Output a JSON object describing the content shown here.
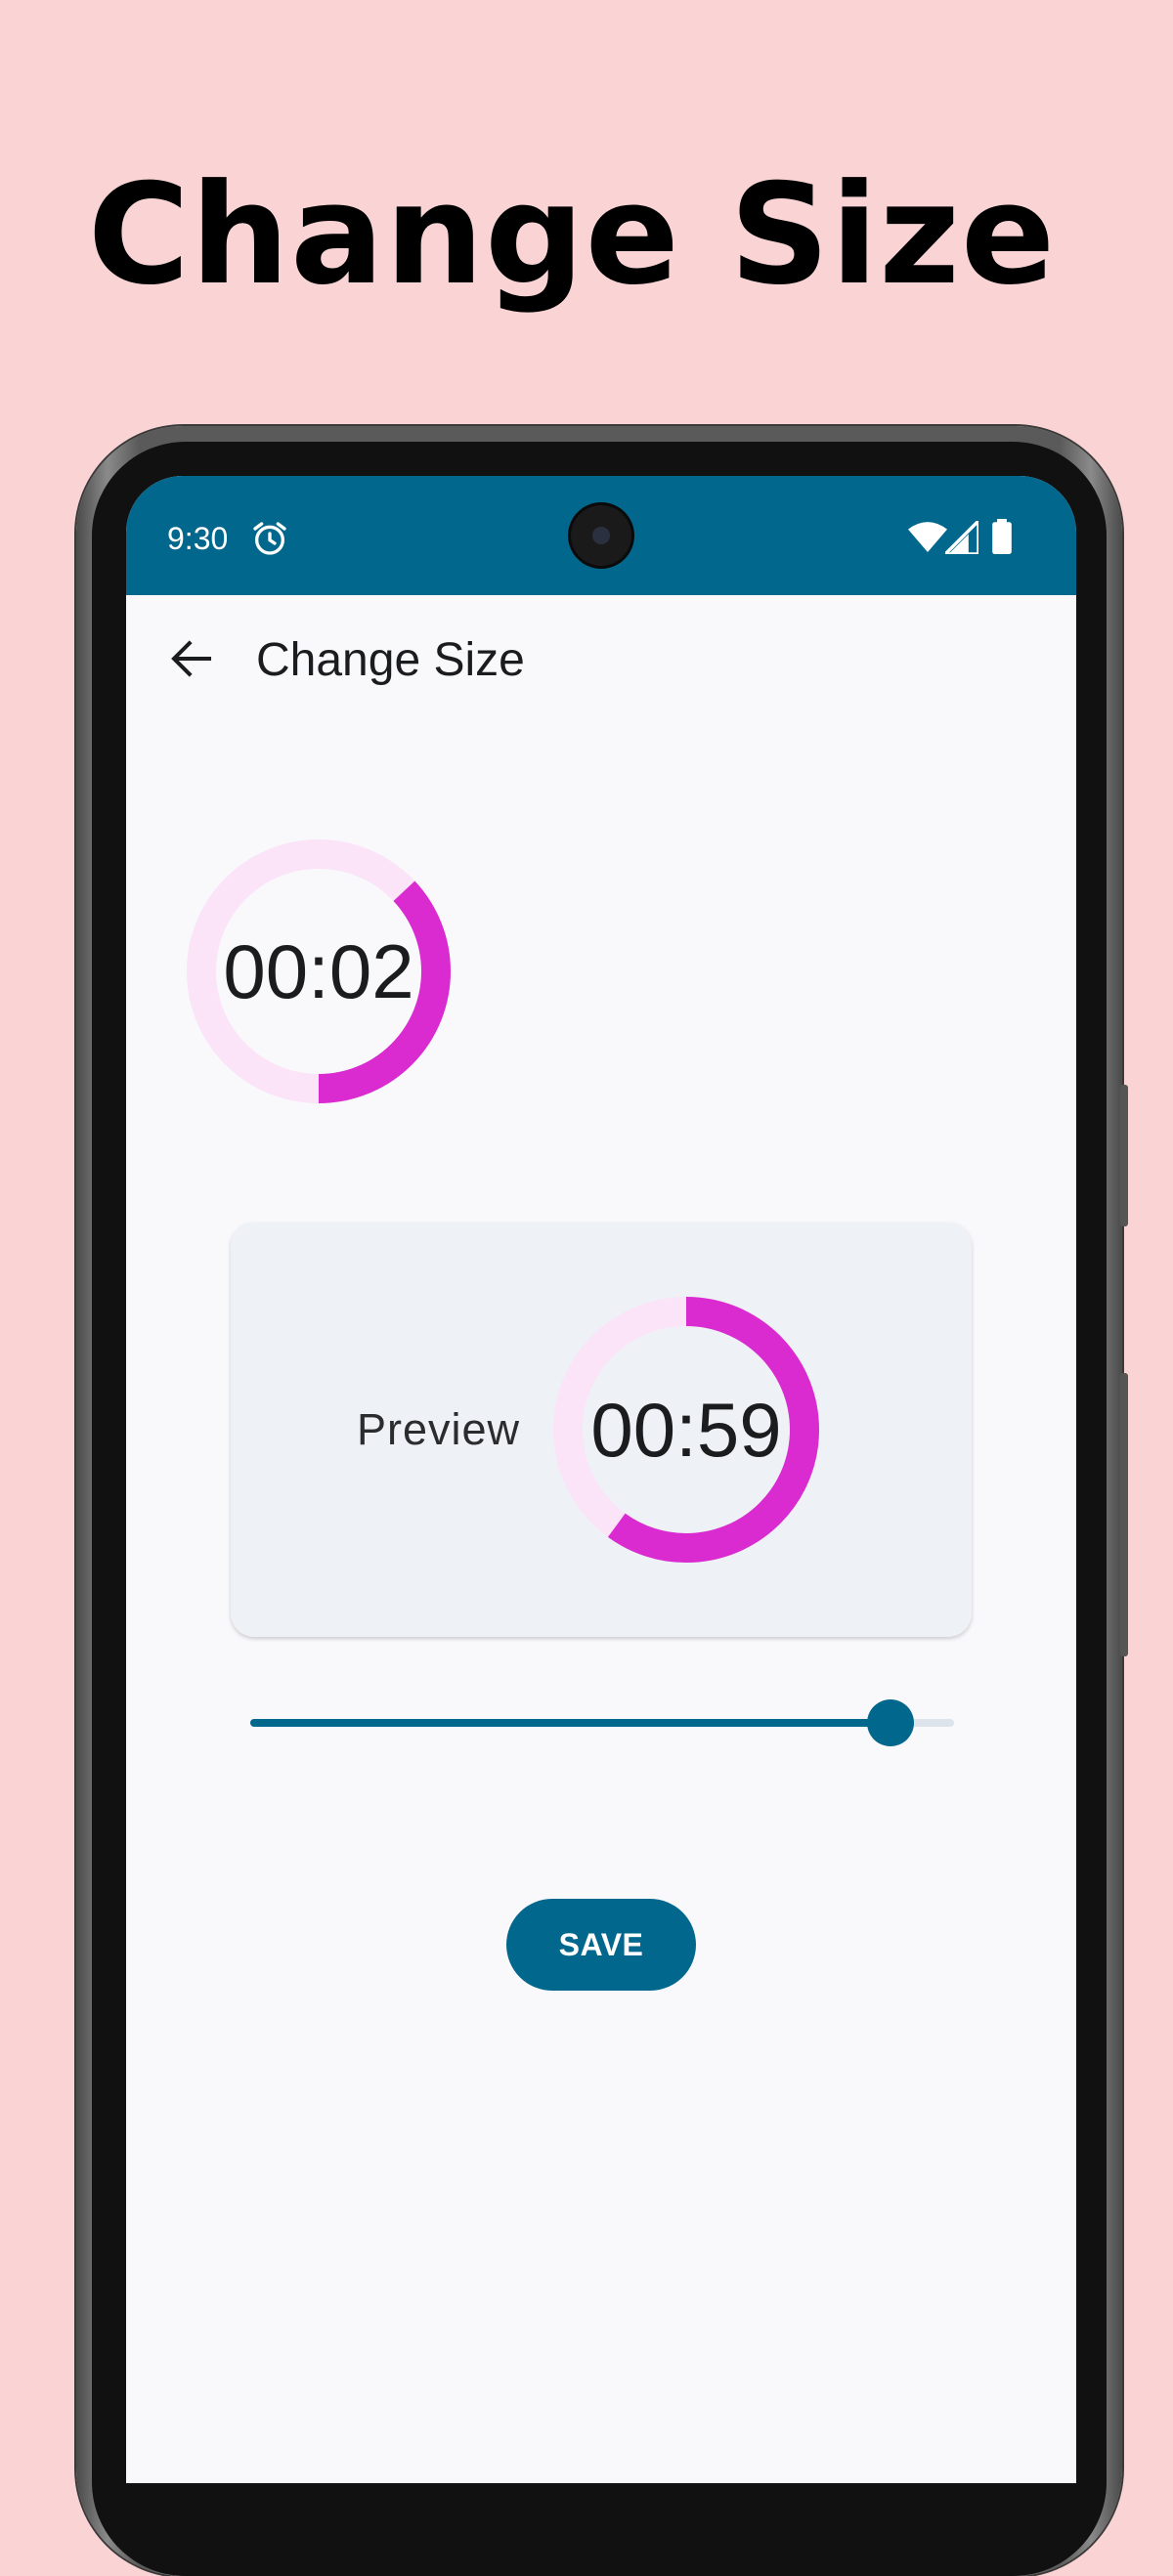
{
  "promo": {
    "title": "Change Size"
  },
  "status_bar": {
    "time": "9:30",
    "icons": [
      "alarm-icon",
      "wifi-icon",
      "signal-icon",
      "battery-icon"
    ],
    "color": "#02678c"
  },
  "app_bar": {
    "back_icon": "arrow-left-icon",
    "title": "Change Size"
  },
  "timer": {
    "value": "00:02",
    "progress": 0.37
  },
  "preview": {
    "label": "Preview",
    "timer_value": "00:59",
    "progress": 0.6
  },
  "size_slider": {
    "value": 0.91
  },
  "actions": {
    "save_label": "SAVE"
  },
  "colors": {
    "accent": "#02678c",
    "ring_progress": "#d92bd0",
    "ring_track": "#fbe3f8",
    "background": "#fad4d4",
    "screen_bg": "#f9f9fc",
    "card_bg": "#eef2f7"
  }
}
